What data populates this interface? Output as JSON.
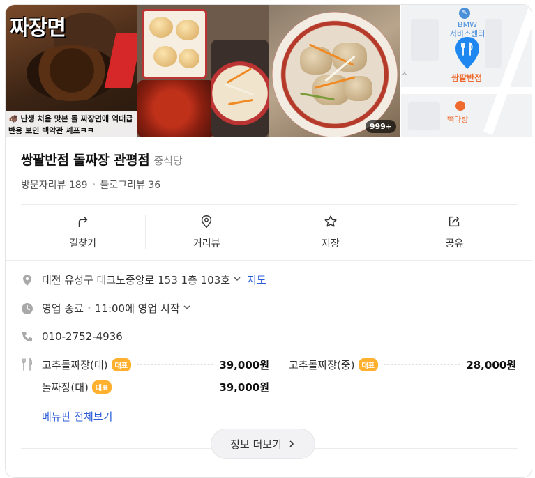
{
  "photos": {
    "thumb_title": "짜장면",
    "thumb_caption_line1": "🐗 난생 처음 맛본 돌 짜장면에 역대급",
    "thumb_caption_line2": "반응 보인 백악관 셰프ㅋㅋ",
    "photo_count_badge": "999+"
  },
  "map": {
    "poi_bmw": "BMW\n서비스센터",
    "poi_restaurant": "쌍팔반점",
    "poi_cafe": "빽다방",
    "poi_partial": "스"
  },
  "place": {
    "name": "쌍팔반점 돌짜장 관평점",
    "category": "중식당",
    "visitor_reviews": "방문자리뷰 189",
    "blog_reviews": "블로그리뷰 36"
  },
  "actions": [
    {
      "label": "길찾기",
      "icon": "directions-icon"
    },
    {
      "label": "거리뷰",
      "icon": "street-view-icon"
    },
    {
      "label": "저장",
      "icon": "star-icon"
    },
    {
      "label": "공유",
      "icon": "share-icon"
    }
  ],
  "info": {
    "address": "대전 유성구 테크노중앙로 153 1층 103호",
    "map_link": "지도",
    "hours_status": "영업 종료",
    "hours_detail": "11:00에 영업 시작",
    "phone": "010-2752-4936"
  },
  "menu": {
    "items": [
      {
        "name": "고추돌짜장(대)",
        "tag": "대표",
        "price": "39,000원"
      },
      {
        "name": "고추돌짜장(중)",
        "tag": "대표",
        "price": "28,000원"
      },
      {
        "name": "돌짜장(대)",
        "tag": "대표",
        "price": "39,000원"
      }
    ],
    "view_all": "메뉴판 전체보기"
  },
  "more_button": "정보 더보기",
  "colors": {
    "accent_link": "#2a5bd7",
    "tag_orange": "#ffb02e",
    "map_pin": "#1e88f0"
  }
}
